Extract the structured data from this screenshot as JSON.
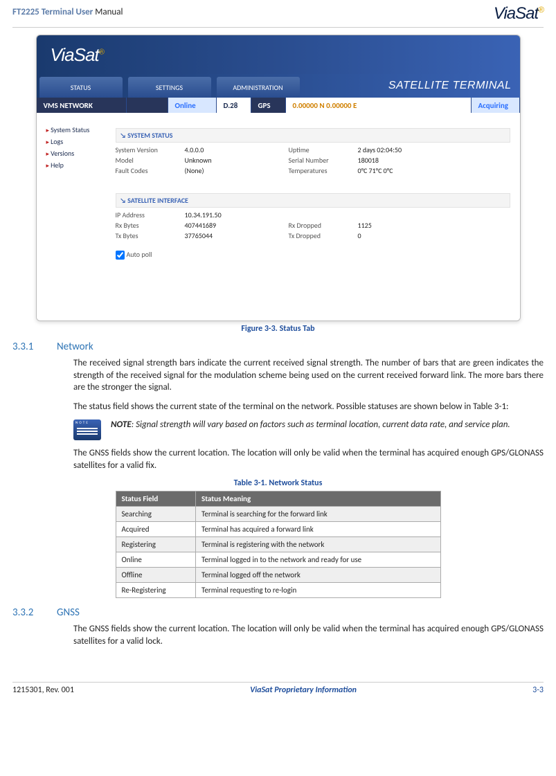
{
  "header": {
    "doc_title_prefix": "FT2225 Terminal User",
    "doc_title_suffix": " Manual",
    "brand": "ViaSat"
  },
  "screenshot": {
    "logo": "ViaSat",
    "tabs": [
      "STATUS",
      "SETTINGS",
      "ADMINISTRATION"
    ],
    "sat_label": "SATELLITE TERMINAL",
    "statusbar": {
      "vms": "VMS NETWORK",
      "online": "Online",
      "d": "D.28",
      "gps": "GPS",
      "coords": "0.00000 N 0.00000 E",
      "acq": "Acquiring"
    },
    "sidemenu": [
      "System Status",
      "Logs",
      "Versions",
      "Help"
    ],
    "panel_system": {
      "title": "SYSTEM STATUS",
      "rows": [
        {
          "k": "System Version",
          "v": "4.0.0.0",
          "k2": "Uptime",
          "v2": "2 days 02:04:50"
        },
        {
          "k": "Model",
          "v": "Unknown",
          "k2": "Serial Number",
          "v2": "180018"
        },
        {
          "k": "Fault Codes",
          "v": "(None)",
          "k2": "Temperatures",
          "v2": "0°C  71°C  0°C"
        }
      ]
    },
    "panel_sat": {
      "title": "SATELLITE INTERFACE",
      "rows": [
        {
          "k": "IP Address",
          "v": "10.34.191.50",
          "k2": "",
          "v2": ""
        },
        {
          "k": "Rx Bytes",
          "v": "407441689",
          "k2": "Rx Dropped",
          "v2": "1125"
        },
        {
          "k": "Tx Bytes",
          "v": "37765044",
          "k2": "Tx Dropped",
          "v2": "0"
        }
      ]
    },
    "autopoll": "Auto poll"
  },
  "fig_caption": "Figure 3-3. Status Tab",
  "sec331": {
    "num": "3.3.1",
    "title": "Network"
  },
  "para1": "The received signal strength bars indicate the current received signal strength. The number of bars that are green indicates the strength of the received signal for the modulation scheme being used on the current received forward link.  The more bars there are the stronger the signal.",
  "para2": "The status field shows the current state of the terminal on the network. Possible statuses are shown below in Table 3-1:",
  "note": {
    "bold": "NOTE",
    "text": ": Signal strength will vary based on factors such as terminal location, current data rate, and service plan."
  },
  "para3": "The GNSS fields show the current location. The location will only be valid when the terminal has acquired enough GPS/GLONASS satellites for a valid fix.",
  "table_caption": "Table 3-1.  Network Status",
  "table": {
    "headers": [
      "Status Field",
      "Status Meaning"
    ],
    "rows": [
      [
        "Searching",
        "Terminal is searching for the forward link"
      ],
      [
        "Acquired",
        "Terminal has acquired a forward link"
      ],
      [
        "Registering",
        "Terminal is registering with the network"
      ],
      [
        "Online",
        "Terminal logged in to the network and ready for use"
      ],
      [
        "Offline",
        "Terminal logged off the network"
      ],
      [
        "Re-Registering",
        "Terminal requesting to re-login"
      ]
    ]
  },
  "sec332": {
    "num": "3.3.2",
    "title": "GNSS"
  },
  "para4": "The GNSS fields show the current location. The location will only be valid when the terminal has acquired enough GPS/GLONASS satellites for a valid lock.",
  "footer": {
    "left": "1215301, Rev.  001",
    "mid": "ViaSat Proprietary Information",
    "right": "3-3"
  }
}
